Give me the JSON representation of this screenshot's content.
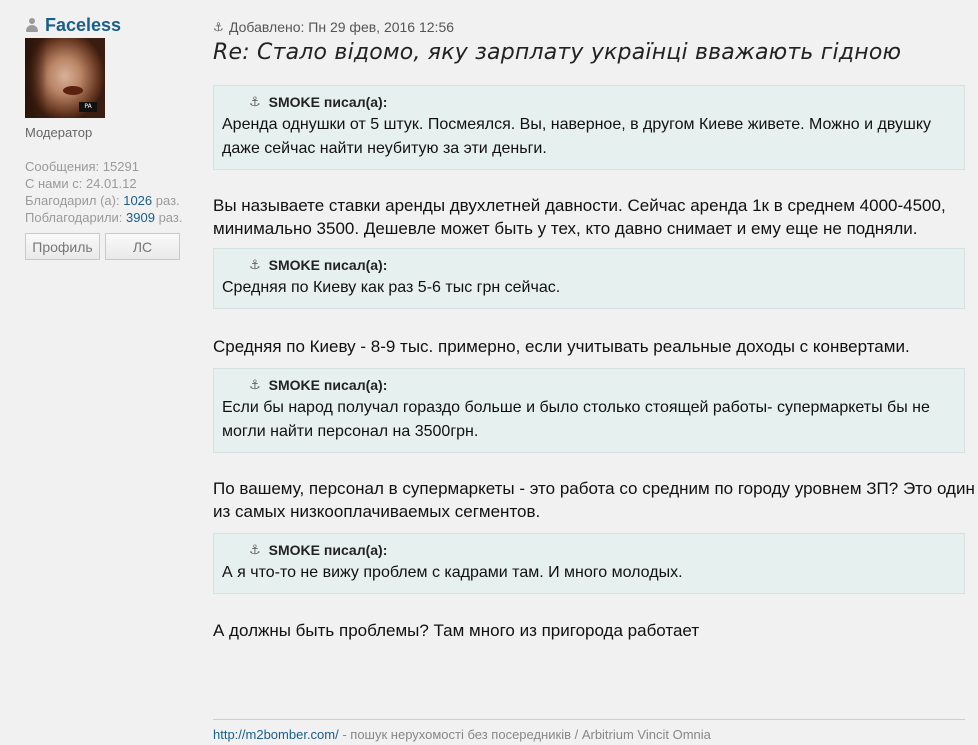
{
  "author": {
    "name": "Faceless",
    "rank": "Модератор",
    "messages_label": "Сообщения: ",
    "messages": "15291",
    "since_label": "С нами с: ",
    "since": "24.01.12",
    "thanked_label": "Благодарил (а): ",
    "thanked": "1026",
    "thanked_suffix": " раз.",
    "thanks_received_label": "Поблагодарили: ",
    "thanks_received": "3909",
    "thanks_received_suffix": " раз.",
    "profile_button": "Профиль",
    "pm_button": "ЛС"
  },
  "post": {
    "added": "Добавлено: Пн 29 фев, 2016 12:56",
    "subject": "Re: Стало відомо, яку зарплату українці вважають гідною",
    "blocks": [
      {
        "type": "quote",
        "author": "SMOKE писал(а):",
        "text": "Аренда однушки от 5 штук. Посмеялся. Вы, наверное, в другом Киеве живете. Можно и двушку даже сейчас найти неубитую за эти деньги."
      },
      {
        "type": "para",
        "text": "Вы называете ставки аренды двухлетней давности. Сейчас аренда 1к в среднем 4000-4500, минимально 3500. Дешевле может быть у тех, кто давно снимает и ему еще не подняли."
      },
      {
        "type": "quote",
        "author": "SMOKE писал(а):",
        "text": "Средняя по Киеву как раз 5-6 тыс грн сейчас."
      },
      {
        "type": "para",
        "text": "Средняя по Киеву - 8-9 тыс. примерно, если учитывать реальные доходы с конвертами."
      },
      {
        "type": "quote",
        "author": "SMOKE писал(а):",
        "text": "Если бы народ получал гораздо больше и было столько стоящей работы- супермаркеты бы не могли найти персонал на 3500грн."
      },
      {
        "type": "para",
        "text": "По вашему, персонал в супермаркеты - это работа со средним по городу уровнем ЗП? Это один из самых низкооплачиваемых сегментов."
      },
      {
        "type": "quote",
        "author": "SMOKE писал(а):",
        "text": "А я что-то не вижу проблем с кадрами там. И много молодых."
      },
      {
        "type": "para",
        "text": "А должны быть проблемы? Там много из пригорода работает"
      }
    ]
  },
  "signature": {
    "link": "http://m2bomber.com/",
    "text": " - пошук нерухомості без посередників / Arbitrium Vincit Omnia"
  }
}
